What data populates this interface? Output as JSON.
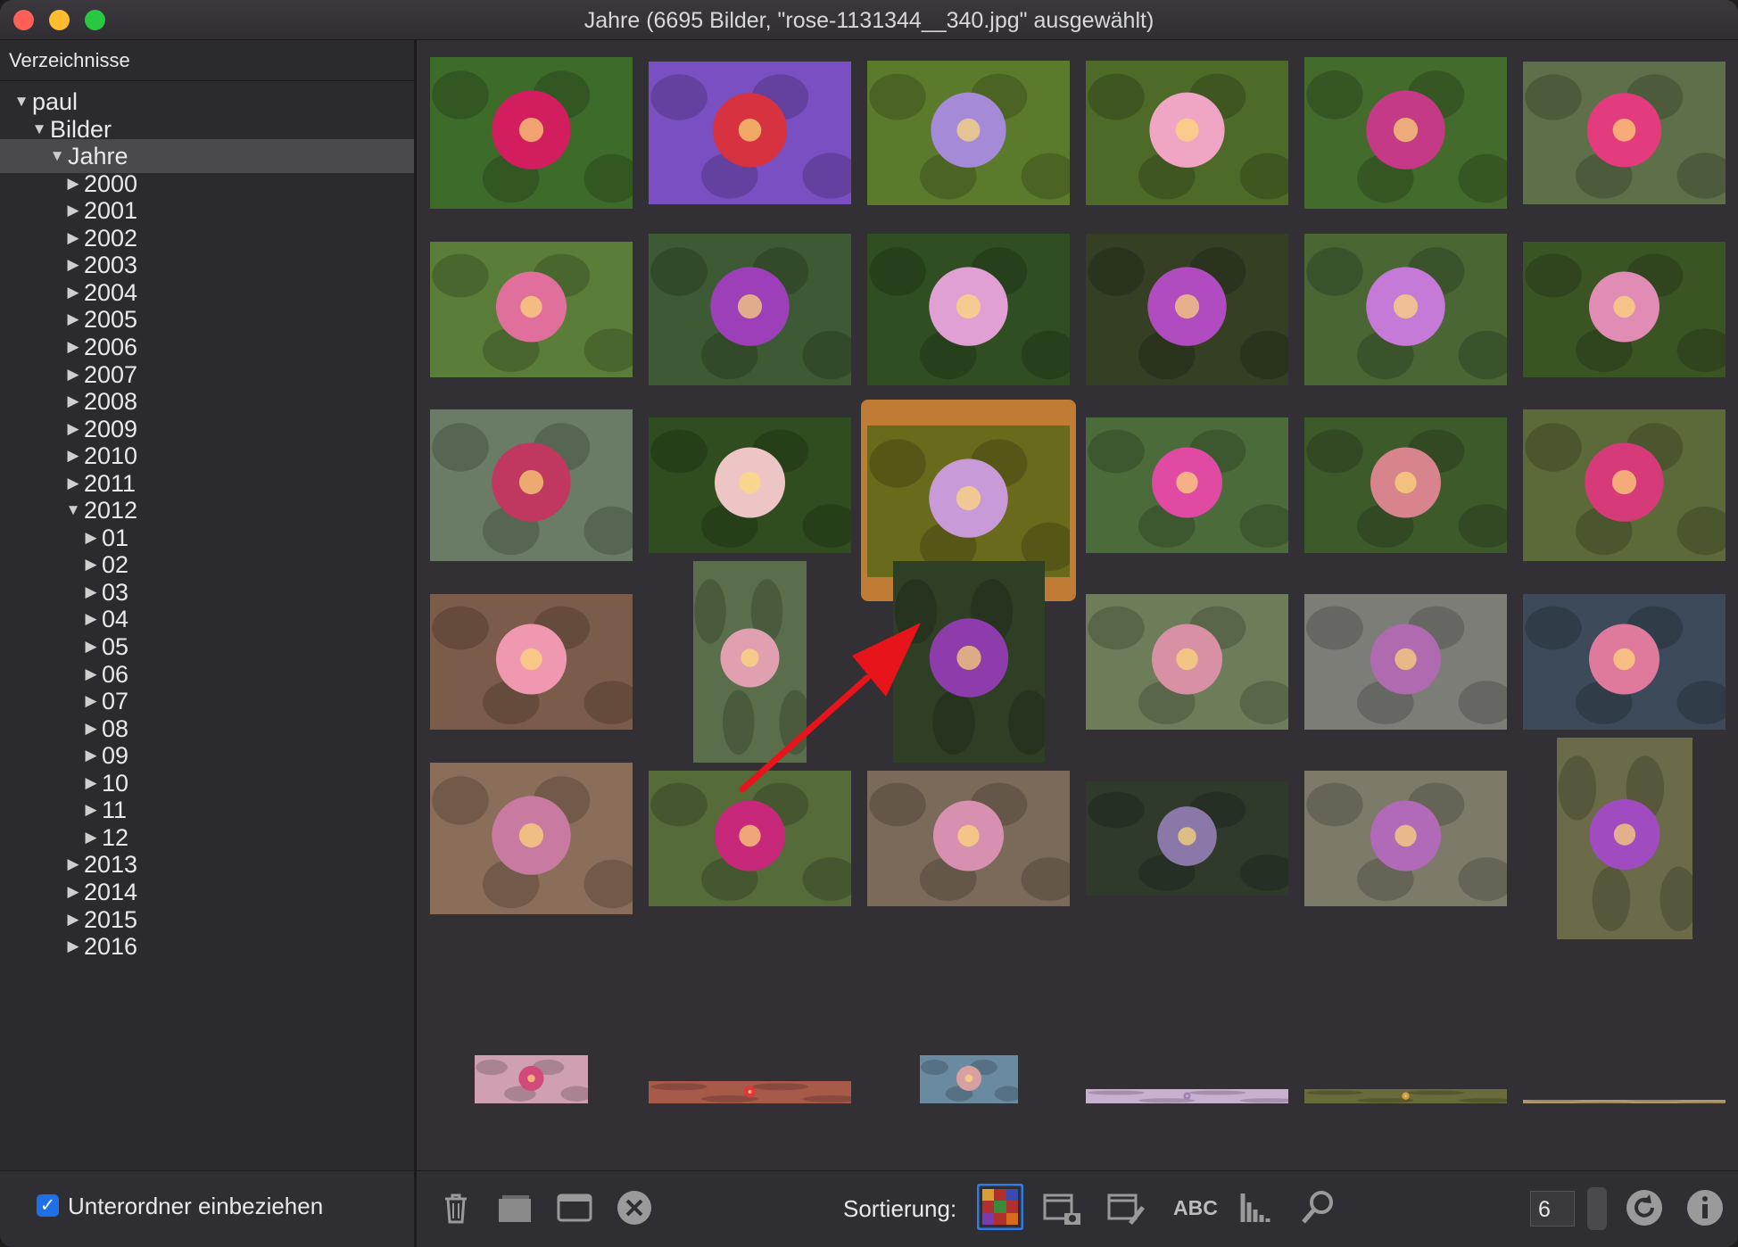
{
  "window": {
    "title": "Jahre (6695 Bilder, \"rose-1131344__340.jpg\" ausgewählt)"
  },
  "sidebar": {
    "header": "Verzeichnisse",
    "items": [
      {
        "label": "paul",
        "expanded": true
      },
      {
        "label": "Bilder",
        "expanded": true
      },
      {
        "label": "Jahre",
        "expanded": true,
        "selected": true
      },
      {
        "label": "2000"
      },
      {
        "label": "2001"
      },
      {
        "label": "2002"
      },
      {
        "label": "2003"
      },
      {
        "label": "2004"
      },
      {
        "label": "2005"
      },
      {
        "label": "2006"
      },
      {
        "label": "2007"
      },
      {
        "label": "2008"
      },
      {
        "label": "2009"
      },
      {
        "label": "2010"
      },
      {
        "label": "2011"
      },
      {
        "label": "2012",
        "expanded": true
      },
      {
        "label": "01"
      },
      {
        "label": "02"
      },
      {
        "label": "03"
      },
      {
        "label": "04"
      },
      {
        "label": "05"
      },
      {
        "label": "06"
      },
      {
        "label": "07"
      },
      {
        "label": "08"
      },
      {
        "label": "09"
      },
      {
        "label": "10"
      },
      {
        "label": "11"
      },
      {
        "label": "12"
      },
      {
        "label": "2013"
      },
      {
        "label": "2014"
      },
      {
        "label": "2015"
      },
      {
        "label": "2016"
      }
    ],
    "footer": {
      "checkbox_label": "Unterordner einbeziehen",
      "checked": true
    }
  },
  "toolbar": {
    "sort_label": "Sortierung:",
    "abc_label": "ABC",
    "columns_value": "6",
    "icons": [
      "trash-icon",
      "folder-icon",
      "window-icon",
      "close-circle-icon",
      "color-grid-icon",
      "calendar-camera-icon",
      "calendar-edit-icon",
      "abc-sort-icon",
      "histogram-icon",
      "search-icon",
      "refresh-icon",
      "info-icon"
    ]
  },
  "colors": {
    "selection": "#c07c35",
    "accent": "#1e70e6",
    "arrow": "#e8141b"
  },
  "thumbnails": [
    {
      "bg": "#3d6b2a",
      "fg": "#d21d5e"
    },
    {
      "bg": "#7a4fc2",
      "fg": "#d6323f"
    },
    {
      "bg": "#5c7a2c",
      "fg": "#a58ad8"
    },
    {
      "bg": "#4e6a28",
      "fg": "#f0a5c4"
    },
    {
      "bg": "#436b2b",
      "fg": "#c43a86"
    },
    {
      "bg": "#5d7049",
      "fg": "#e43b7e"
    },
    {
      "bg": "#5b7d3a",
      "fg": "#e0709b"
    },
    {
      "bg": "#3d5a34",
      "fg": "#9c3fb8"
    },
    {
      "bg": "#2f4f22",
      "fg": "#e0a0d4"
    },
    {
      "bg": "#343f24",
      "fg": "#b04cc0"
    },
    {
      "bg": "#496634",
      "fg": "#c57ad8"
    },
    {
      "bg": "#3b5424",
      "fg": "#e08cb4"
    },
    {
      "bg": "#6b7c66",
      "fg": "#c0375f"
    },
    {
      "bg": "#2f4d1f",
      "fg": "#ecc5c4"
    },
    {
      "bg": "#6a6a1c",
      "fg": "#c89ad8"
    },
    {
      "bg": "#4b6b3a",
      "fg": "#e04aa3"
    },
    {
      "bg": "#3d5a2b",
      "fg": "#d8848c"
    },
    {
      "bg": "#5c6a3a",
      "fg": "#d63a78"
    },
    {
      "bg": "#7b5c4a",
      "fg": "#f098b0"
    },
    {
      "bg": "#5a6e4b",
      "fg": "#e0a0b0"
    },
    {
      "bg": "#2f3f26",
      "fg": "#8e3cab"
    },
    {
      "bg": "#6d7d5a",
      "fg": "#d890a4"
    },
    {
      "bg": "#7d7d78",
      "fg": "#b06ab0"
    },
    {
      "bg": "#3c4a5a",
      "fg": "#e07a9c"
    },
    {
      "bg": "#8a6e5a",
      "fg": "#c87aa0"
    },
    {
      "bg": "#556b3a",
      "fg": "#c8287a"
    },
    {
      "bg": "#7a6a5a",
      "fg": "#d890b0"
    },
    {
      "bg": "#2f3a2b",
      "fg": "#8a78a8"
    },
    {
      "bg": "#7d7a6a",
      "fg": "#b06ab8"
    },
    {
      "bg": "#6b6b4a",
      "fg": "#a04cc0"
    },
    {
      "bg": "#cfa0b4",
      "fg": "#d04a7a"
    },
    {
      "bg": "#a85a4a",
      "fg": "#d83a3a"
    },
    {
      "bg": "#6a8aa0",
      "fg": "#d8a0a0"
    },
    {
      "bg": "#c8b0d0",
      "fg": "#a080c0"
    },
    {
      "bg": "#6a6a3a",
      "fg": "#d0a040"
    },
    {
      "bg": "#b09a6a",
      "fg": "#c09060"
    }
  ]
}
